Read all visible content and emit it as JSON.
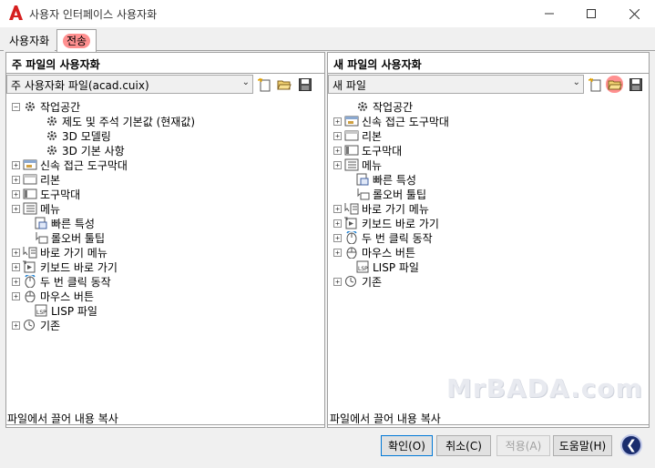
{
  "window": {
    "title": "사용자 인터페이스 사용자화"
  },
  "tabs": [
    {
      "label": "사용자화"
    },
    {
      "label": "전송"
    }
  ],
  "left_panel": {
    "heading": "주 파일의 사용자화",
    "combo_value": "주 사용자화 파일(acad.cuix)",
    "tree": [
      {
        "label": "작업공간",
        "icon": "workspace-icon"
      },
      {
        "label": "제도 및 주석 기본값 (현재값)",
        "icon": "workspace-icon"
      },
      {
        "label": "3D 모델링",
        "icon": "workspace-icon"
      },
      {
        "label": "3D 기본 사항",
        "icon": "workspace-icon"
      },
      {
        "label": "신속 접근 도구막대",
        "icon": "quick-access-toolbar-icon"
      },
      {
        "label": "리본",
        "icon": "ribbon-icon"
      },
      {
        "label": "도구막대",
        "icon": "toolbar-icon"
      },
      {
        "label": "메뉴",
        "icon": "menu-icon"
      },
      {
        "label": "빠른 특성",
        "icon": "quick-properties-icon"
      },
      {
        "label": "롤오버 툴팁",
        "icon": "rollover-tooltip-icon"
      },
      {
        "label": "바로 가기 메뉴",
        "icon": "shortcut-menu-icon"
      },
      {
        "label": "키보드 바로 가기",
        "icon": "keyboard-shortcut-icon"
      },
      {
        "label": "두 번 클릭 동작",
        "icon": "double-click-icon"
      },
      {
        "label": "마우스 버튼",
        "icon": "mouse-button-icon"
      },
      {
        "label": "LISP 파일",
        "icon": "lisp-file-icon"
      },
      {
        "label": "기존",
        "icon": "legacy-icon"
      }
    ],
    "status": "파일에서 끌어 내용 복사"
  },
  "right_panel": {
    "heading": "새 파일의 사용자화",
    "combo_value": "새 파일",
    "tree": [
      {
        "label": "작업공간",
        "icon": "workspace-icon"
      },
      {
        "label": "신속 접근 도구막대",
        "icon": "quick-access-toolbar-icon"
      },
      {
        "label": "리본",
        "icon": "ribbon-icon"
      },
      {
        "label": "도구막대",
        "icon": "toolbar-icon"
      },
      {
        "label": "메뉴",
        "icon": "menu-icon"
      },
      {
        "label": "빠른 특성",
        "icon": "quick-properties-icon"
      },
      {
        "label": "롤오버 툴팁",
        "icon": "rollover-tooltip-icon"
      },
      {
        "label": "바로 가기 메뉴",
        "icon": "shortcut-menu-icon"
      },
      {
        "label": "키보드 바로 가기",
        "icon": "keyboard-shortcut-icon"
      },
      {
        "label": "두 번 클릭 동작",
        "icon": "double-click-icon"
      },
      {
        "label": "마우스 버튼",
        "icon": "mouse-button-icon"
      },
      {
        "label": "LISP 파일",
        "icon": "lisp-file-icon"
      },
      {
        "label": "기존",
        "icon": "legacy-icon"
      }
    ],
    "status": "파일에서 끌어 내용 복사"
  },
  "buttons": {
    "ok": "확인(O)",
    "cancel": "취소(C)",
    "apply": "적용(A)",
    "help": "도움말(H)"
  },
  "watermark": "MrBADA.com",
  "colors": {
    "highlight": "#ff9090",
    "brand_red": "#d62020",
    "back_button": "#1a2d6e"
  }
}
